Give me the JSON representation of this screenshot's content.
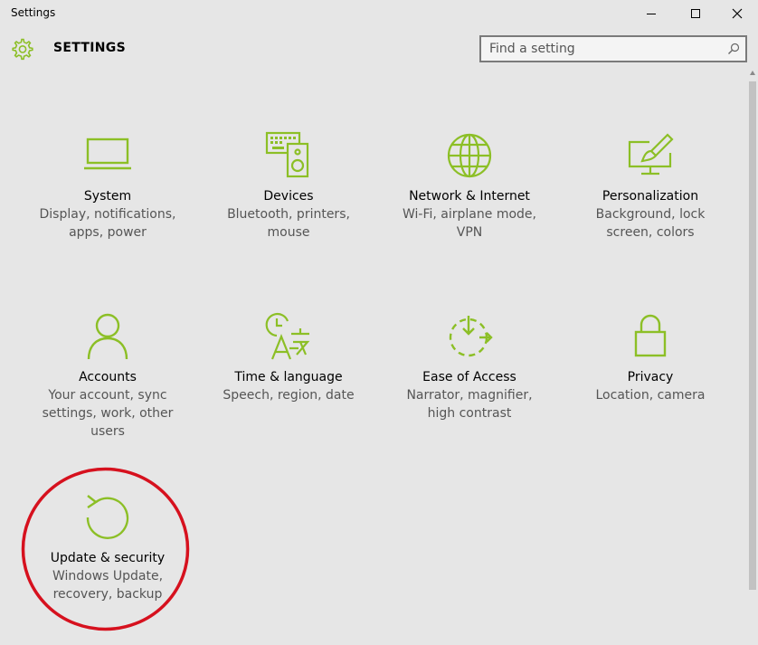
{
  "window": {
    "title": "Settings",
    "controls": {
      "minimize": "minimize-icon",
      "maximize": "maximize-icon",
      "close": "close-icon"
    }
  },
  "header": {
    "title": "SETTINGS",
    "icon": "gear-icon"
  },
  "search": {
    "placeholder": "Find a setting",
    "value": "",
    "icon": "search-icon"
  },
  "accent_color": "#8cbf26",
  "annotation": {
    "type": "circle",
    "color": "#d6111e",
    "target": "Update & security"
  },
  "categories": [
    {
      "id": "system",
      "icon": "laptop-icon",
      "label": "System",
      "desc": "Display, notifications, apps, power"
    },
    {
      "id": "devices",
      "icon": "keyboard-speaker-icon",
      "label": "Devices",
      "desc": "Bluetooth, printers, mouse"
    },
    {
      "id": "network",
      "icon": "globe-icon",
      "label": "Network & Internet",
      "desc": "Wi-Fi, airplane mode, VPN"
    },
    {
      "id": "personalization",
      "icon": "paintbrush-screen-icon",
      "label": "Personalization",
      "desc": "Background, lock screen, colors"
    },
    {
      "id": "accounts",
      "icon": "person-icon",
      "label": "Accounts",
      "desc": "Your account, sync settings, work, other users"
    },
    {
      "id": "time-language",
      "icon": "clock-language-icon",
      "label": "Time & language",
      "desc": "Speech, region, date"
    },
    {
      "id": "ease-of-access",
      "icon": "ease-of-access-icon",
      "label": "Ease of Access",
      "desc": "Narrator, magnifier, high contrast"
    },
    {
      "id": "privacy",
      "icon": "lock-icon",
      "label": "Privacy",
      "desc": "Location, camera"
    },
    {
      "id": "update-security",
      "icon": "refresh-icon",
      "label": "Update & security",
      "desc": "Windows Update, recovery, backup"
    }
  ]
}
